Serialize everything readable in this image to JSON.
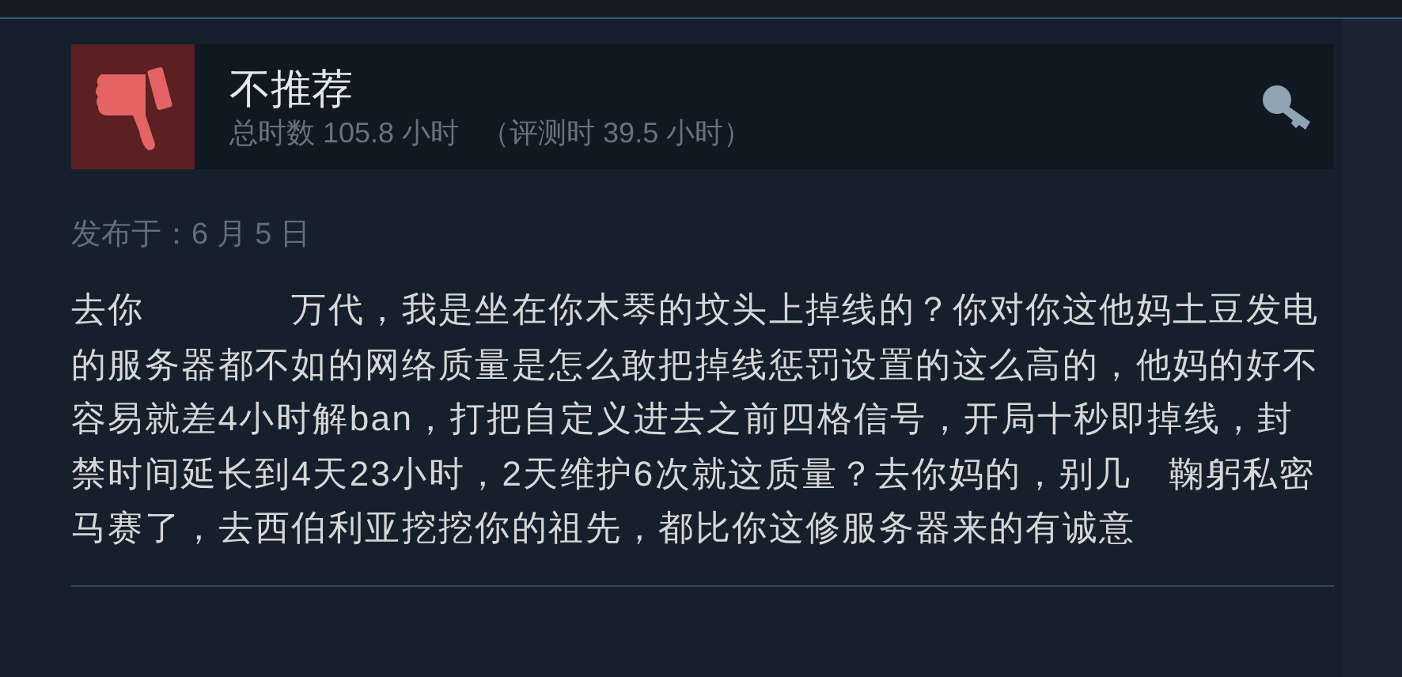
{
  "review": {
    "verdict": "不推荐",
    "hours": "总时数 105.8 小时",
    "review_hours": "（评测时 39.5 小时）",
    "posted": "发布于：6 月 5 日",
    "body": "去你　　　　万代，我是坐在你木琴的坟头上掉线的？你对你这他妈土豆发电的服务器都不如的网络质量是怎么敢把掉线惩罚设置的这么高的，他妈的好不容易就差4小时解ban，打把自定义进去之前四格信号，开局十秒即掉线，封禁时间延长到4天23小时，2天维护6次就这质量？去你妈的，别几　鞠躬私密马赛了，去西伯利亚挖挖你的祖先，都比你这修服务器来的有诚意"
  }
}
